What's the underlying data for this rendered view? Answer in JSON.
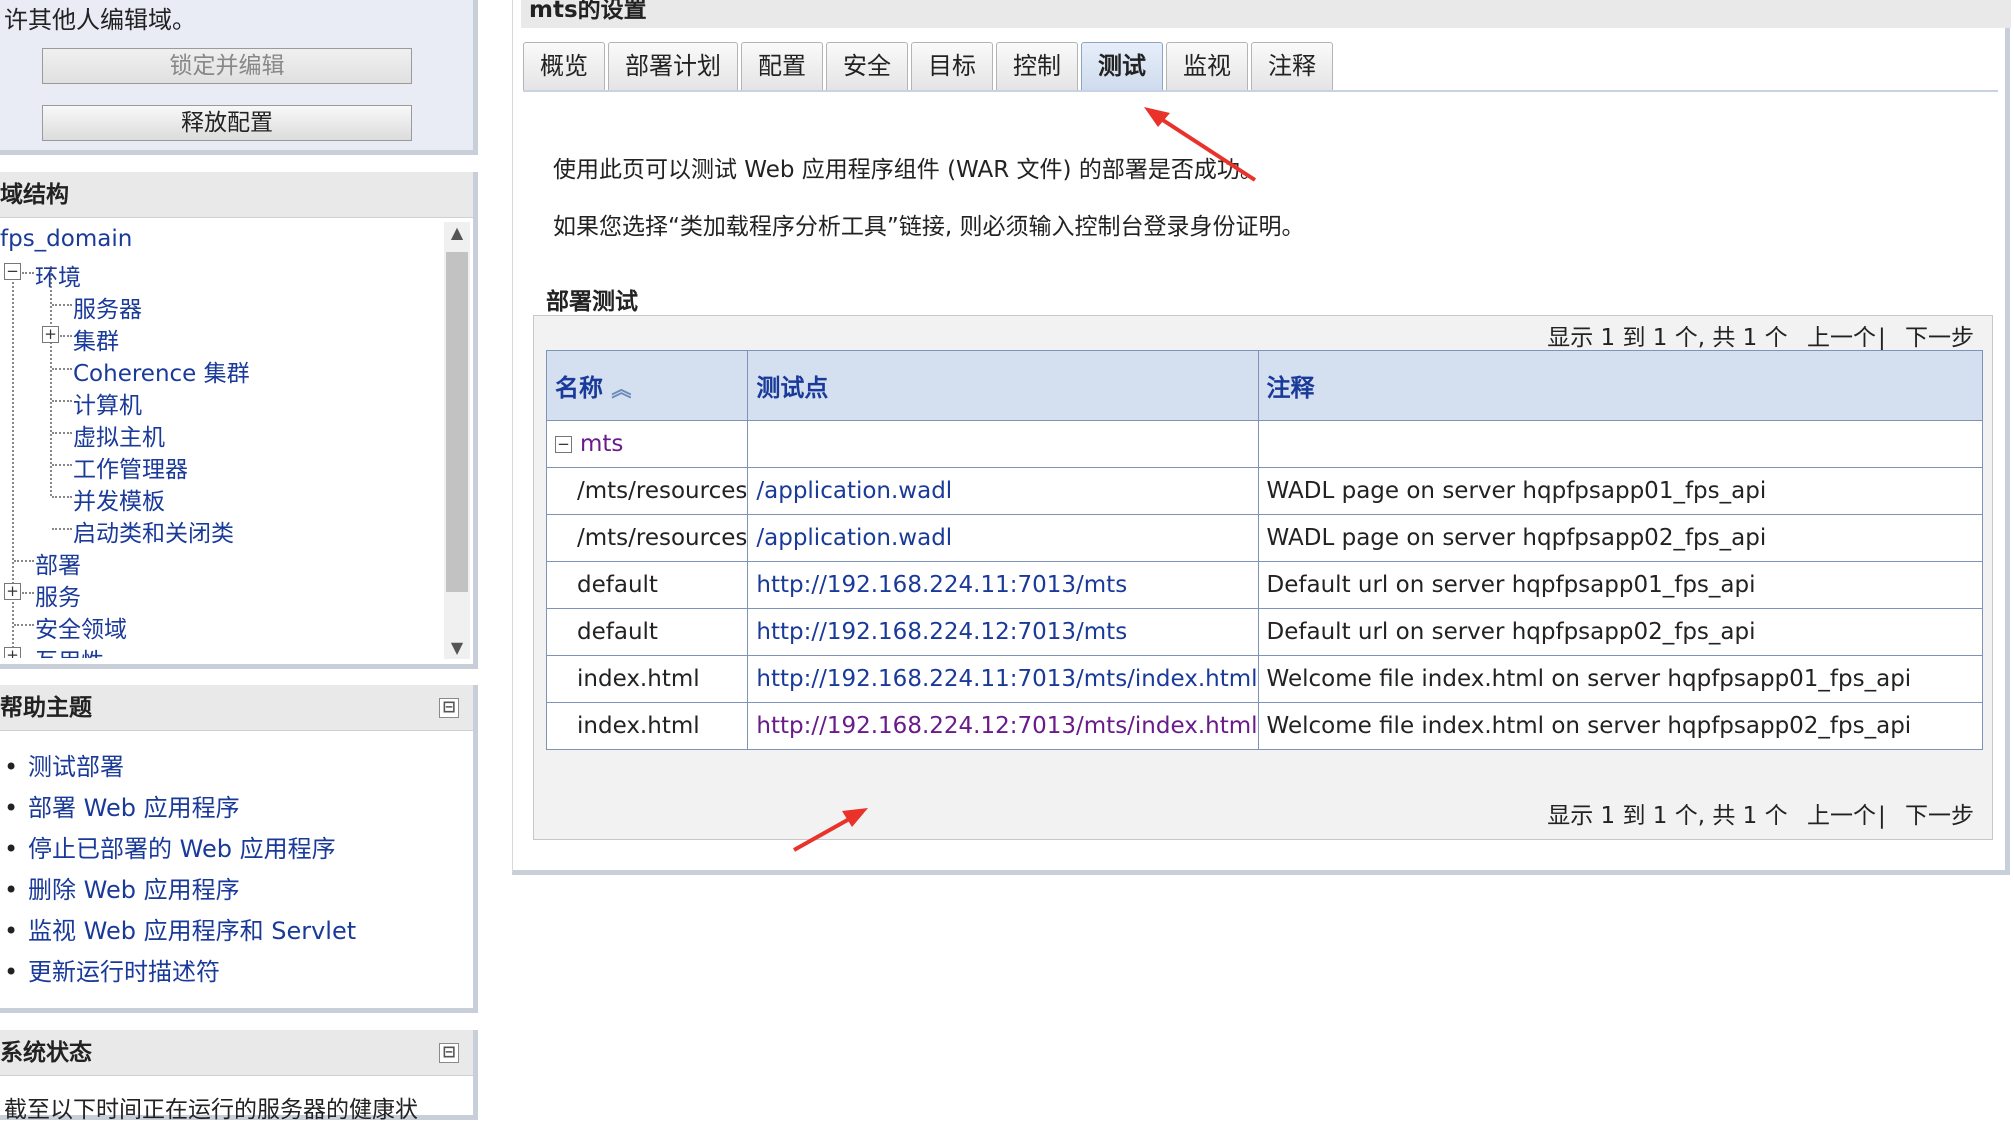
{
  "lock_panel": {
    "text": "许其他人编辑域。",
    "lock_button": "锁定并编辑",
    "release_button": "释放配置"
  },
  "domain_structure": {
    "title": "域结构",
    "root": "fps_domain",
    "items": {
      "env": "环境",
      "servers": "服务器",
      "clusters": "集群",
      "coherence": "Coherence 集群",
      "machines": "计算机",
      "vhosts": "虚拟主机",
      "workmgr": "工作管理器",
      "concurrency": "并发模板",
      "startup": "启动类和关闭类",
      "deploy": "部署",
      "services": "服务",
      "security": "安全领域",
      "interop": "互用性"
    }
  },
  "help": {
    "title": "帮助主题",
    "collapse": "⊟",
    "items": [
      "测试部署",
      "部署 Web 应用程序",
      "停止已部署的 Web 应用程序",
      "删除 Web 应用程序",
      "监视 Web 应用程序和 Servlet",
      "更新运行时描述符"
    ]
  },
  "status": {
    "title": "系统状态",
    "collapse": "⊟",
    "text": "截至以下时间正在运行的服务器的健康状"
  },
  "main": {
    "title": "mts的设置",
    "tabs": [
      "概览",
      "部署计划",
      "配置",
      "安全",
      "目标",
      "控制",
      "测试",
      "监视",
      "注释"
    ],
    "active_tab": "测试",
    "intro1": "使用此页可以测试 Web 应用程序组件 (WAR 文件) 的部署是否成功。",
    "intro2": "如果您选择“类加载程序分析工具”链接, 则必须输入控制台登录身份证明。",
    "section_title": "部署测试",
    "pager": {
      "summary": "显示 1 到 1 个, 共 1 个",
      "prev": "上一个",
      "sep": "|",
      "next": "下一步"
    },
    "table": {
      "headers": [
        "名称",
        "测试点",
        "注释"
      ],
      "group": "mts",
      "rows": [
        {
          "name": "/mts/resources",
          "point": "/application.wadl",
          "note": "WADL page on server hqpfpsapp01_fps_api"
        },
        {
          "name": "/mts/resources",
          "point": "/application.wadl",
          "note": "WADL page on server hqpfpsapp02_fps_api"
        },
        {
          "name": "default",
          "point": "http://192.168.224.11:7013/mts",
          "note": "Default url on server hqpfpsapp01_fps_api"
        },
        {
          "name": "default",
          "point": "http://192.168.224.12:7013/mts",
          "note": "Default url on server hqpfpsapp02_fps_api"
        },
        {
          "name": "index.html",
          "point": "http://192.168.224.11:7013/mts/index.html",
          "note": "Welcome file index.html on server hqpfpsapp01_fps_api"
        },
        {
          "name": "index.html",
          "point": "http://192.168.224.12:7013/mts/index.html",
          "note": "Welcome file index.html on server hqpfpsapp02_fps_api"
        }
      ]
    }
  },
  "colors": {
    "link": "#1a3a9a",
    "visited": "#6a1a8a",
    "arrow": "#e8322a",
    "header_bg": "#d4dff0"
  }
}
